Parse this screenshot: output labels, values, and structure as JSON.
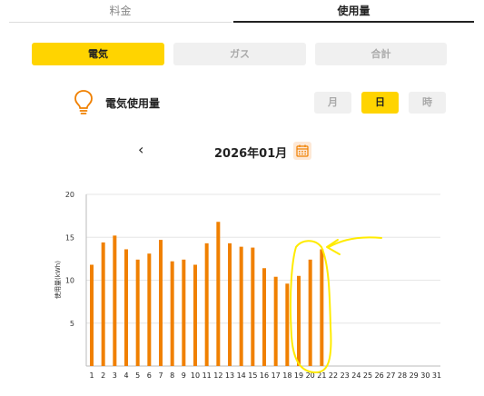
{
  "tabs": {
    "fee": "料金",
    "usage": "使用量"
  },
  "energy": {
    "electricity": "電気",
    "gas": "ガス",
    "total": "合計"
  },
  "usage_title": "電気使用量",
  "period": {
    "month": "月",
    "day": "日",
    "hour": "時"
  },
  "month_nav": {
    "prev": "‹",
    "current": "2026年01月"
  },
  "colors": {
    "accent": "#ffd400",
    "bar": "#f08000",
    "icon": "#f08000"
  },
  "chart_data": {
    "type": "bar",
    "ylabel": "使用量(kWh)",
    "ylim": [
      0,
      20
    ],
    "yticks": [
      5,
      10,
      15,
      20
    ],
    "categories": [
      "1",
      "2",
      "3",
      "4",
      "5",
      "6",
      "7",
      "8",
      "9",
      "10",
      "11",
      "12",
      "13",
      "14",
      "15",
      "16",
      "17",
      "18",
      "19",
      "20",
      "21",
      "22",
      "23",
      "24",
      "25",
      "26",
      "27",
      "28",
      "29",
      "30",
      "31"
    ],
    "values": [
      11.8,
      14.4,
      15.2,
      13.6,
      12.4,
      13.1,
      14.7,
      12.2,
      12.4,
      11.8,
      14.3,
      16.8,
      14.3,
      13.9,
      13.8,
      11.4,
      10.4,
      9.6,
      10.5,
      12.4,
      13.6,
      null,
      null,
      null,
      null,
      null,
      null,
      null,
      null,
      null,
      null
    ]
  }
}
